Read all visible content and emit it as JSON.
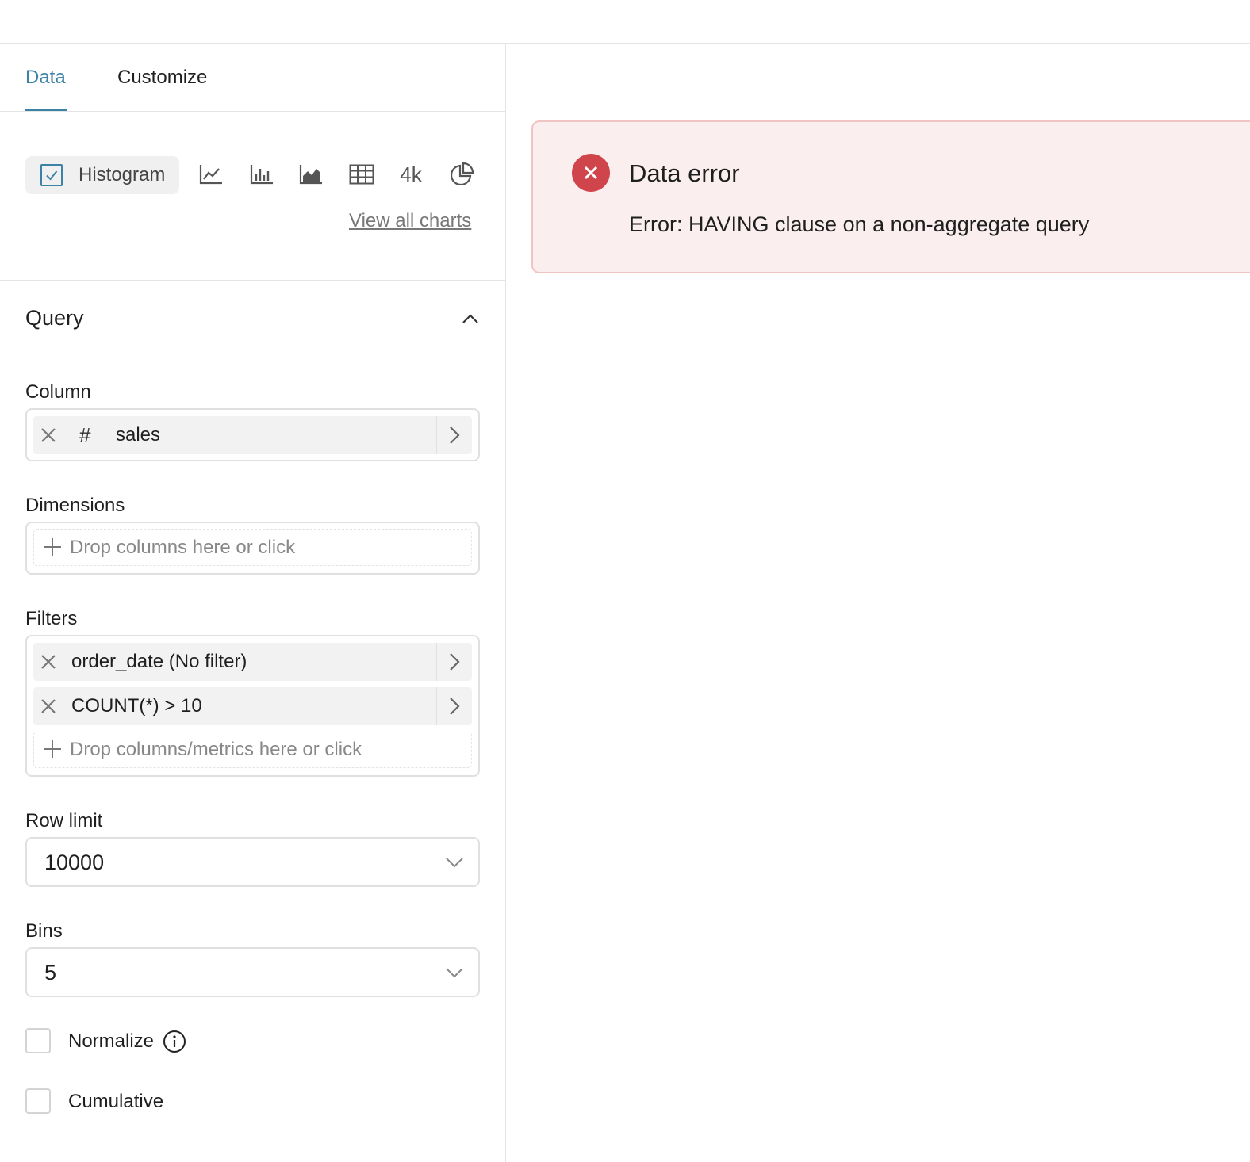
{
  "tabs": {
    "data": "Data",
    "customize": "Customize"
  },
  "chart_picker": {
    "selected": "Histogram",
    "big_number_label": "4k",
    "view_all": "View all charts"
  },
  "query": {
    "title": "Query",
    "column": {
      "label": "Column",
      "value": "sales"
    },
    "dimensions": {
      "label": "Dimensions",
      "placeholder": "Drop columns here or click"
    },
    "filters": {
      "label": "Filters",
      "items": [
        "order_date (No filter)",
        "COUNT(*) > 10"
      ],
      "placeholder": "Drop columns/metrics here or click"
    },
    "row_limit": {
      "label": "Row limit",
      "value": "10000"
    },
    "bins": {
      "label": "Bins",
      "value": "5"
    },
    "normalize": {
      "label": "Normalize",
      "checked": false
    },
    "cumulative": {
      "label": "Cumulative",
      "checked": false
    }
  },
  "error": {
    "title": "Data error",
    "message": "Error: HAVING clause on a non-aggregate query"
  },
  "colors": {
    "accent": "#3b82a6",
    "error_bg": "#fbeeee",
    "error_icon": "#d0454c"
  }
}
